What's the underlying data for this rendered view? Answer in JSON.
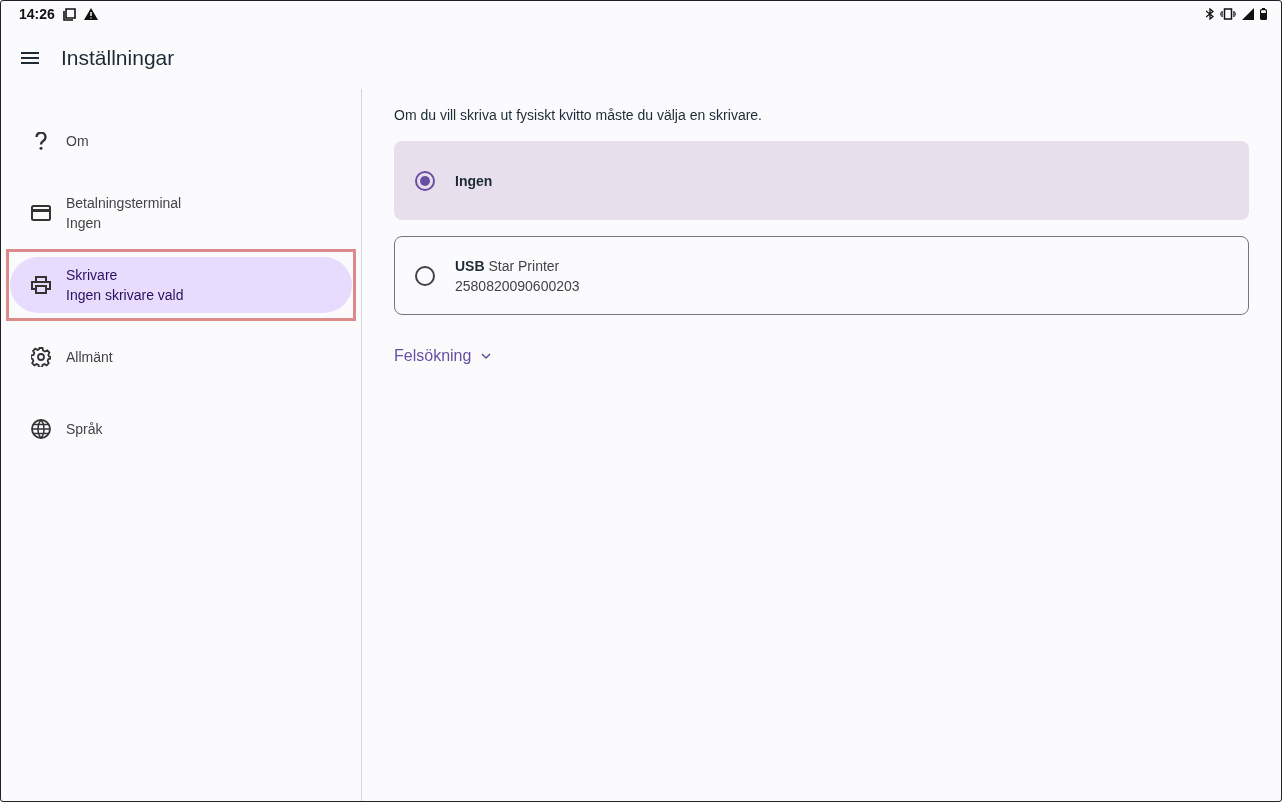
{
  "status_bar": {
    "time": "14:26"
  },
  "app_bar": {
    "title": "Inställningar"
  },
  "sidebar": {
    "items": [
      {
        "title": "Om",
        "selected": false,
        "highlighted": false
      },
      {
        "title": "Betalningsterminal",
        "subtitle": "Ingen",
        "selected": false,
        "highlighted": false
      },
      {
        "title": "Skrivare",
        "subtitle": "Ingen skrivare vald",
        "selected": true,
        "highlighted": true
      },
      {
        "title": "Allmänt",
        "selected": false,
        "highlighted": false
      },
      {
        "title": "Språk",
        "selected": false,
        "highlighted": false
      }
    ]
  },
  "content": {
    "intro": "Om du vill skriva ut fysiskt kvitto måste du välja en skrivare.",
    "options": [
      {
        "title": "Ingen",
        "selected": true
      },
      {
        "title": "**USB** Star Printer",
        "subtitle": "2580820090600203",
        "selected": false
      }
    ],
    "troubleshooting": {
      "label": "Felsökning",
      "expanded": false
    }
  }
}
